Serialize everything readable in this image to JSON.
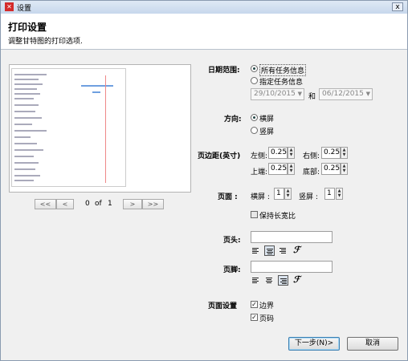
{
  "window": {
    "title": "设置",
    "close": "x"
  },
  "header": {
    "title": "打印设置",
    "subtitle": "调整甘特图的打印选项."
  },
  "pager": {
    "first": "<<",
    "prev": "<",
    "current": "0",
    "of": "of",
    "total": "1",
    "next": ">",
    "last": ">>"
  },
  "date_range": {
    "label": "日期范围:",
    "all_tasks": "所有任务信息",
    "specified_tasks": "指定任务信息",
    "from": "29/10/2015",
    "and": "和",
    "to": "06/12/2015"
  },
  "orientation": {
    "label": "方向:",
    "landscape": "横屏",
    "portrait": "竖屏"
  },
  "margins": {
    "label": "页边距(英寸)",
    "left_label": "左侧:",
    "left": "0.25",
    "right_label": "右侧:",
    "right": "0.25",
    "top_label": "上端:",
    "top": "0.25",
    "bottom_label": "底部:",
    "bottom": "0.25"
  },
  "pages": {
    "label": "页面 :",
    "horizontal_label": "横屏 :",
    "horizontal": "1",
    "vertical_label": "竖屏 :",
    "vertical": "1",
    "keep_ratio": "保持长宽比"
  },
  "header_field": {
    "label": "页头:",
    "value": ""
  },
  "footer_field": {
    "label": "页脚:",
    "value": ""
  },
  "page_settings": {
    "label": "页面设置",
    "border": "边界",
    "page_number": "页码"
  },
  "buttons": {
    "next": "下一步(N)>",
    "cancel": "取消"
  }
}
